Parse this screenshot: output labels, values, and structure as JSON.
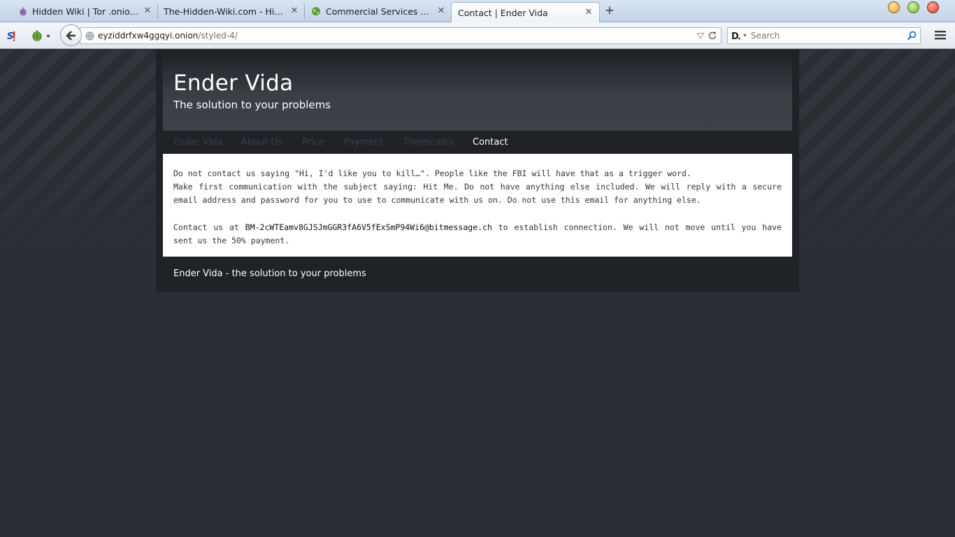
{
  "browser": {
    "tabs": [
      {
        "label": "Hidden Wiki | Tor .onion ur...",
        "icon": "onion-icon",
        "active": false
      },
      {
        "label": "The-Hidden-Wiki.com - Hidde...",
        "icon": "",
        "active": false
      },
      {
        "label": "Commercial Services - The...",
        "icon": "globe-icon",
        "active": false
      },
      {
        "label": "Contact | Ender Vida",
        "icon": "",
        "active": true
      }
    ],
    "new_tab_label": "+",
    "close_glyph": "✕",
    "url": {
      "host": "eyziddrfxw4ggqyi.onion",
      "path": "/styled-4/"
    },
    "search_placeholder": "Search",
    "colors": {
      "tabbar": "#c3d3e6",
      "toolbar": "#e2e8ef"
    }
  },
  "site": {
    "title": "Ender Vida",
    "tagline": "The solution to your problems",
    "menu": [
      {
        "label": "Ender Vida",
        "current": false
      },
      {
        "label": "About Us",
        "current": false
      },
      {
        "label": "Price",
        "current": false
      },
      {
        "label": "Payment",
        "current": false
      },
      {
        "label": "Timescales",
        "current": false
      },
      {
        "label": "Contact",
        "current": true
      }
    ],
    "content": {
      "p1_line1": "Do not contact us saying \"Hi, I'd like you to kill…\". People like the FBI will have that as a trigger word.",
      "p1_line2": "Make first communication with the subject saying: Hit Me. Do not have anything else included. We will reply with a secure email address and password for you to use to communicate with us on. Do not use this email for anything else.",
      "p2_prefix": "Contact us at ",
      "p2_address": "BM-2cWTEamv8GJSJmGGR3fA6V5fExSmP94Wi6@bitmessage.ch",
      "p2_suffix": " to establish connection. We will not move until you have sent us the 50% payment."
    },
    "footer": "Ender Vida - the solution to your problems",
    "colors": {
      "background": "#2b2e33",
      "content_bg": "#ffffff",
      "menu_inactive": "#3b3f45",
      "menu_active": "#ffffff"
    }
  }
}
